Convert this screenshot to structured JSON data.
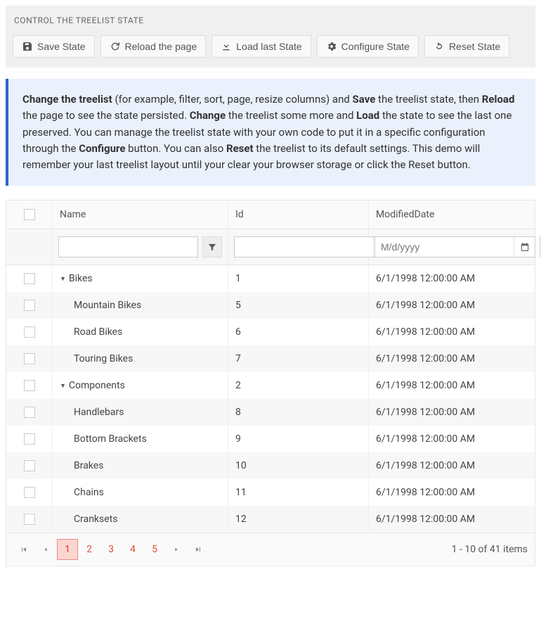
{
  "controlTitle": "CONTROL THE TREELIST STATE",
  "buttons": {
    "save": "Save State",
    "reload": "Reload the page",
    "load": "Load last State",
    "configure": "Configure State",
    "reset": "Reset State"
  },
  "info": {
    "p1a": "Change the treelist",
    "p1b": " (for example, filter, sort, page, resize columns) and ",
    "p1c": "Save",
    "p1d": " the treelist state, then ",
    "p2a": "Reload",
    "p2b": " the page to see the state persisted. ",
    "p2c": "Change",
    "p2d": " the treelist some more and ",
    "p2e": "Load",
    "p2f": " the state to see the last one preserved. You can manage the treelist state with your own code to put it in a specific configuration through the ",
    "p2g": "Configure",
    "p2h": " button. You can also ",
    "p2i": "Reset",
    "p2j": " the treelist to its default settings. This demo will remember your last treelist layout until your clear your browser storage or click the Reset button."
  },
  "columns": {
    "name": "Name",
    "id": "Id",
    "modified": "ModifiedDate"
  },
  "filters": {
    "datePlaceholder": "M/d/yyyy"
  },
  "rows": [
    {
      "name": "Bikes",
      "id": "1",
      "modified": "6/1/1998 12:00:00 AM",
      "indent": 0,
      "expandable": true
    },
    {
      "name": "Mountain Bikes",
      "id": "5",
      "modified": "6/1/1998 12:00:00 AM",
      "indent": 1,
      "expandable": false
    },
    {
      "name": "Road Bikes",
      "id": "6",
      "modified": "6/1/1998 12:00:00 AM",
      "indent": 1,
      "expandable": false
    },
    {
      "name": "Touring Bikes",
      "id": "7",
      "modified": "6/1/1998 12:00:00 AM",
      "indent": 1,
      "expandable": false
    },
    {
      "name": "Components",
      "id": "2",
      "modified": "6/1/1998 12:00:00 AM",
      "indent": 0,
      "expandable": true
    },
    {
      "name": "Handlebars",
      "id": "8",
      "modified": "6/1/1998 12:00:00 AM",
      "indent": 1,
      "expandable": false
    },
    {
      "name": "Bottom Brackets",
      "id": "9",
      "modified": "6/1/1998 12:00:00 AM",
      "indent": 1,
      "expandable": false
    },
    {
      "name": "Brakes",
      "id": "10",
      "modified": "6/1/1998 12:00:00 AM",
      "indent": 1,
      "expandable": false
    },
    {
      "name": "Chains",
      "id": "11",
      "modified": "6/1/1998 12:00:00 AM",
      "indent": 1,
      "expandable": false
    },
    {
      "name": "Cranksets",
      "id": "12",
      "modified": "6/1/1998 12:00:00 AM",
      "indent": 1,
      "expandable": false
    }
  ],
  "pager": {
    "pages": [
      "1",
      "2",
      "3",
      "4",
      "5"
    ],
    "info": "1 - 10 of 41 items"
  }
}
